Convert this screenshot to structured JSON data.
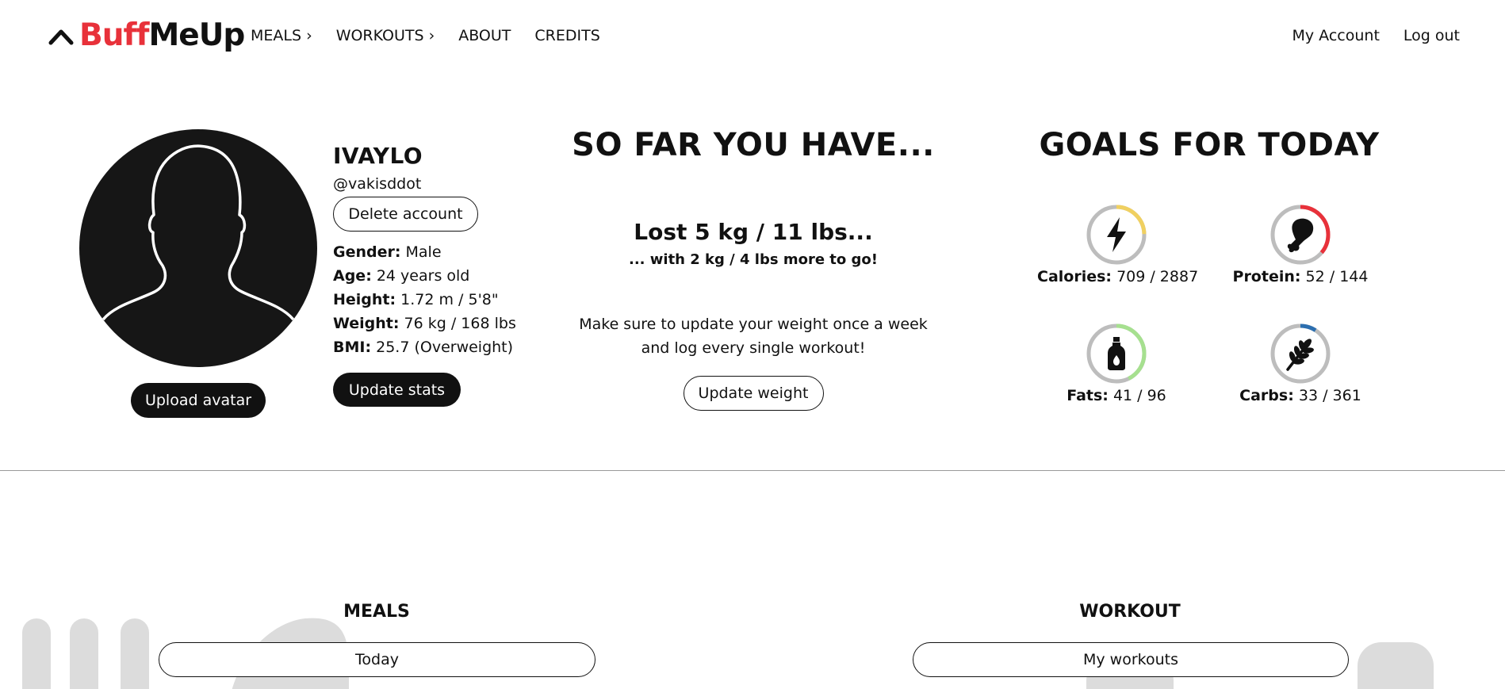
{
  "brand": {
    "name_part1": "Buff",
    "name_part2": "MeUp",
    "accent_color": "#e8313a"
  },
  "nav": {
    "links": [
      "MEALS ›",
      "WORKOUTS ›",
      "ABOUT",
      "CREDITS"
    ],
    "right": [
      "My Account",
      "Log out"
    ]
  },
  "profile": {
    "name": "IVAYLO",
    "handle": "@vakisddot",
    "delete_label": "Delete account",
    "upload_label": "Upload avatar",
    "update_stats_label": "Update stats",
    "stats": [
      {
        "label": "Gender:",
        "value": "Male"
      },
      {
        "label": "Age:",
        "value": "24 years old"
      },
      {
        "label": "Height:",
        "value": "1.72 m / 5'8\""
      },
      {
        "label": "Weight:",
        "value": "76 kg / 168 lbs"
      },
      {
        "label": "BMI:",
        "value": "25.7 (Overweight)"
      }
    ]
  },
  "progress": {
    "title": "SO FAR YOU HAVE...",
    "lost": "Lost 5 kg / 11 lbs...",
    "to_go": "... with 2 kg / 4 lbs more to go!",
    "reminder_line1": "Make sure to update your weight once a week",
    "reminder_line2": "and log every single workout!",
    "update_weight_label": "Update weight"
  },
  "goals": {
    "title": "GOALS FOR TODAY",
    "items": [
      {
        "icon": "lightning-icon",
        "label": "Calories:",
        "value": "709 / 2887",
        "current": 709,
        "target": 2887,
        "color": "#f0d060"
      },
      {
        "icon": "drumstick-icon",
        "label": "Protein:",
        "value": "52 / 144",
        "current": 52,
        "target": 144,
        "color": "#e8313a"
      },
      {
        "icon": "bottle-icon",
        "label": "Fats:",
        "value": "41 / 96",
        "current": 41,
        "target": 96,
        "color": "#a6e08f"
      },
      {
        "icon": "wheat-icon",
        "label": "Carbs:",
        "value": "33 / 361",
        "current": 33,
        "target": 361,
        "color": "#2c6fb0"
      }
    ]
  },
  "bottom": {
    "meals_title": "MEALS",
    "meals_button": "Today",
    "workout_title": "WORKOUT",
    "workout_button": "My workouts"
  }
}
